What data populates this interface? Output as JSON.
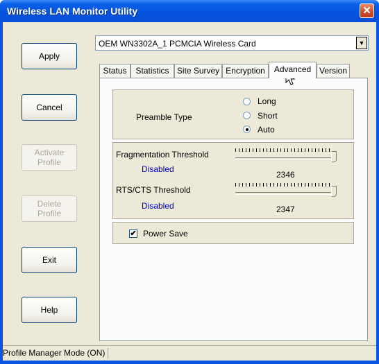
{
  "window": {
    "title": "Wireless LAN Monitor Utility",
    "close_glyph": "✕"
  },
  "side_buttons": {
    "apply": "Apply",
    "cancel": "Cancel",
    "activate_line1": "Activate",
    "activate_line2": "Profile",
    "delete_line1": "Delete",
    "delete_line2": "Profile",
    "exit": "Exit",
    "help": "Help"
  },
  "adapter_select": {
    "value": "OEM WN3302A_1 PCMCIA Wireless Card",
    "arrow": "▼"
  },
  "tabs": [
    "Status",
    "Statistics",
    "Site Survey",
    "Encryption",
    "Advanced",
    "Version"
  ],
  "active_tab": "Advanced",
  "advanced": {
    "preamble": {
      "label": "Preamble Type",
      "options": [
        "Long",
        "Short",
        "Auto"
      ],
      "selected": "Auto"
    },
    "fragmentation": {
      "label": "Fragmentation Threshold",
      "state": "Disabled",
      "value": "2346",
      "slider_fraction": 1.0
    },
    "rts_cts": {
      "label": "RTS/CTS Threshold",
      "state": "Disabled",
      "value": "2347",
      "slider_fraction": 1.0
    },
    "power_save": {
      "label": "Power Save",
      "checked": true,
      "check_glyph": "✔"
    }
  },
  "status_bar": {
    "text": "Profile Manager Mode (ON)"
  },
  "colors": {
    "title_bar": "#0453de",
    "face": "#ece9d8",
    "link_blue": "#0000cc",
    "close_red": "#d24a2a"
  }
}
